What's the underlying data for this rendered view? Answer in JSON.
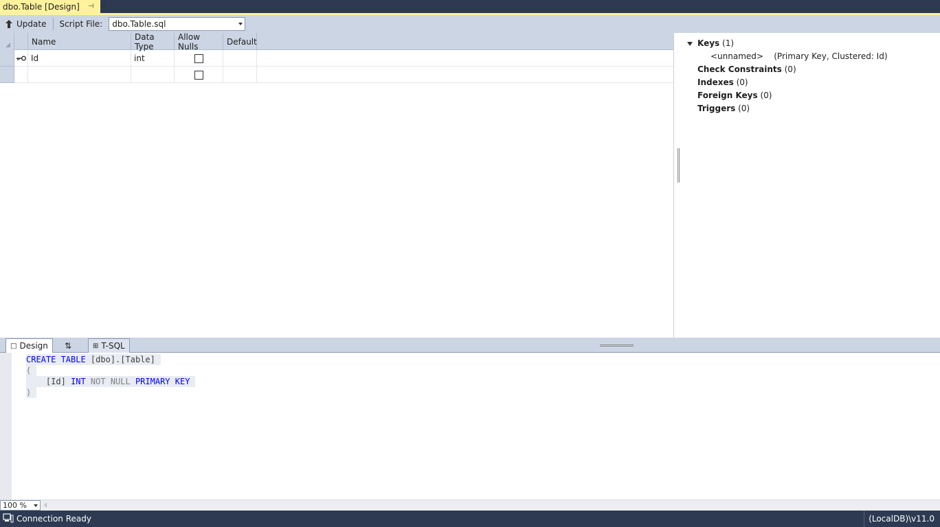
{
  "document_tab": {
    "title": "dbo.Table [Design]"
  },
  "toolbar": {
    "update_label": "Update",
    "script_file_label": "Script File:",
    "script_file_value": "dbo.Table.sql"
  },
  "grid": {
    "columns": [
      "Name",
      "Data Type",
      "Allow Nulls",
      "Default"
    ],
    "rows": [
      {
        "name": "Id",
        "data_type": "int",
        "allow_nulls": false,
        "default": "",
        "is_primary_key": true
      },
      {
        "name": "",
        "data_type": "",
        "allow_nulls": false,
        "default": "",
        "is_primary_key": false
      }
    ]
  },
  "properties": {
    "keys": {
      "label": "Keys",
      "count": "(1)"
    },
    "key_item": {
      "name": "<unnamed>",
      "detail": "(Primary Key, Clustered: Id)"
    },
    "check_constraints": {
      "label": "Check Constraints",
      "count": "(0)"
    },
    "indexes": {
      "label": "Indexes",
      "count": "(0)"
    },
    "foreign_keys": {
      "label": "Foreign Keys",
      "count": "(0)"
    },
    "triggers": {
      "label": "Triggers",
      "count": "(0)"
    }
  },
  "pane_tabs": {
    "design_label": "Design",
    "tsql_label": "T-SQL"
  },
  "sql": {
    "line1_kw": "CREATE TABLE",
    "line1_rest": " [dbo].[Table]",
    "line2": "(",
    "line3_col": "    [Id]",
    "line3_type": " INT",
    "line3_null": " NOT NULL",
    "line3_pk": " PRIMARY KEY",
    "line4": ")"
  },
  "zoom": {
    "value": "100 %"
  },
  "status": {
    "connection": "Connection Ready",
    "server": "(LocalDB)\\v11.0"
  },
  "colors": {
    "titlebar": "#2d3a52",
    "active_tab": "#fff29d",
    "toolbar": "#ccd5e4",
    "keyword": "#0000ff"
  }
}
